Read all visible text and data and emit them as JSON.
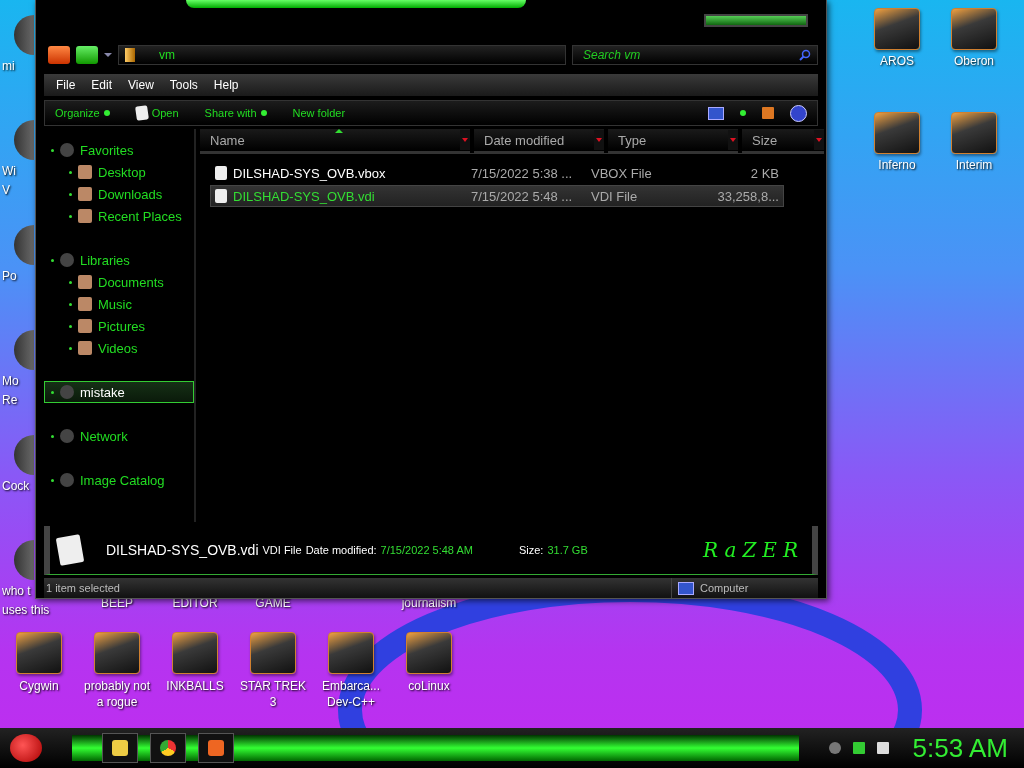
{
  "desktop_left": [
    {
      "lines": [
        "mi"
      ]
    },
    {
      "lines": [
        "Wi",
        "V"
      ]
    },
    {
      "lines": [
        "Po"
      ]
    },
    {
      "lines": [
        "Mo",
        "Re"
      ]
    },
    {
      "lines": [
        "Cock"
      ]
    },
    {
      "lines": [
        "who t",
        "uses this"
      ]
    }
  ],
  "desktop_covered_labels": [
    "BEEP",
    "EDITOR",
    "GAME",
    "journalism"
  ],
  "desktop_right": [
    {
      "label": "AROS"
    },
    {
      "label": "Oberon"
    },
    {
      "label": "Inferno"
    },
    {
      "label": "Interim"
    }
  ],
  "desktop_bottom": [
    {
      "lines": [
        "Cygwin"
      ]
    },
    {
      "lines": [
        "probably not",
        "a rogue"
      ]
    },
    {
      "lines": [
        "INKBALLS"
      ]
    },
    {
      "lines": [
        "STAR TREK",
        "3"
      ]
    },
    {
      "lines": [
        "Embarca...",
        "Dev-C++"
      ]
    },
    {
      "lines": [
        "coLinux"
      ]
    }
  ],
  "window": {
    "address": "vm",
    "search": {
      "placeholder": "Search vm"
    },
    "menu": [
      "File",
      "Edit",
      "View",
      "Tools",
      "Help"
    ],
    "toolbar": [
      {
        "label": "Organize",
        "kind": "dropdown"
      },
      {
        "label": "Open",
        "kind": "icon"
      },
      {
        "label": "Share with",
        "kind": "dropdown"
      },
      {
        "label": "New folder",
        "kind": "plain"
      }
    ],
    "nav": [
      {
        "label": "Favorites",
        "selected": false,
        "children": [
          {
            "label": "Desktop",
            "selected": false
          },
          {
            "label": "Downloads",
            "selected": false
          },
          {
            "label": "Recent Places",
            "selected": false
          }
        ]
      },
      {
        "label": "Libraries",
        "selected": false,
        "children": [
          {
            "label": "Documents",
            "selected": false
          },
          {
            "label": "Music",
            "selected": false
          },
          {
            "label": "Pictures",
            "selected": false
          },
          {
            "label": "Videos",
            "selected": false
          }
        ]
      },
      {
        "label": "mistake",
        "selected": true
      },
      {
        "label": "Network",
        "selected": false
      },
      {
        "label": "Image Catalog",
        "selected": false
      }
    ],
    "columns": [
      {
        "label": "Name",
        "sorted": true
      },
      {
        "label": "Date modified",
        "sorted": false
      },
      {
        "label": "Type",
        "sorted": false
      },
      {
        "label": "Size",
        "sorted": false
      }
    ],
    "rows": [
      {
        "name": "DILSHAD-SYS_OVB.vbox",
        "date": "7/15/2022 5:38 ...",
        "type": "VBOX File",
        "size": "2 KB",
        "selected": false
      },
      {
        "name": "DILSHAD-SYS_OVB.vdi",
        "date": "7/15/2022 5:48 ...",
        "type": "VDI File",
        "size": "33,258,8...",
        "selected": true
      }
    ],
    "details": {
      "name": "DILSHAD-SYS_OVB.vdi",
      "type": "VDI File",
      "date_label": "Date modified:",
      "date": "7/15/2022 5:48 AM",
      "size_label": "Size:",
      "size": "31.7 GB",
      "logo": "RaZER"
    },
    "status": {
      "text": "1 item selected",
      "location": "Computer"
    }
  },
  "taskbar": {
    "clock": "5:53 AM"
  }
}
